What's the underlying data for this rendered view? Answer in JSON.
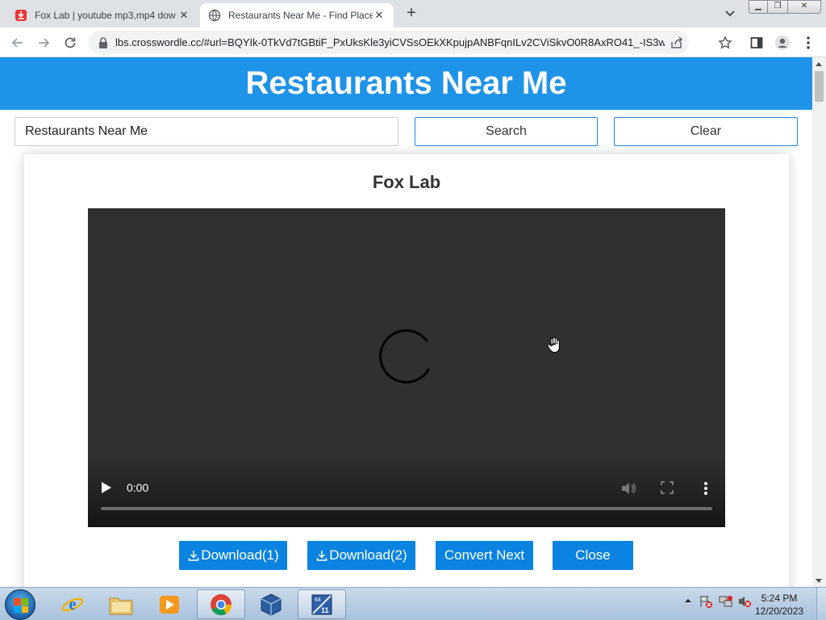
{
  "browser": {
    "tabs": [
      {
        "title": "Fox Lab | youtube mp3,mp4 dow",
        "favicon": "download-icon",
        "active": false
      },
      {
        "title": "Restaurants Near Me - Find Place",
        "favicon": "globe-icon",
        "active": true
      }
    ],
    "new_tab_label": "+",
    "url": "lbs.crosswordle.cc/#url=BQYIk-0TkVd7tGBtiF_PxUksKle3yiCVSsOEkXKpujpANBFqnILv2CViSkvO0R8AxRO41_-IS3w..."
  },
  "page": {
    "banner_title": "Restaurants Near Me",
    "search": {
      "value": "Restaurants Near Me",
      "placeholder": ""
    },
    "search_button": "Search",
    "clear_button": "Clear",
    "card_title": "Fox Lab",
    "video": {
      "time": "0:00",
      "progress": 0
    },
    "buttons": {
      "download1": "Download(1)",
      "download2": "Download(2)",
      "convert_next": "Convert Next",
      "close": "Close"
    }
  },
  "taskbar": {
    "clock_time": "5:24 PM",
    "clock_date": "12/20/2023",
    "apps": [
      "internet-explorer-icon",
      "file-explorer-icon",
      "media-player-icon",
      "chrome-icon",
      "virtualbox-icon",
      "windows11-tool-icon"
    ]
  },
  "colors": {
    "accent": "#1e93e8",
    "button": "#0a84e0",
    "video_bg": "#303030"
  }
}
